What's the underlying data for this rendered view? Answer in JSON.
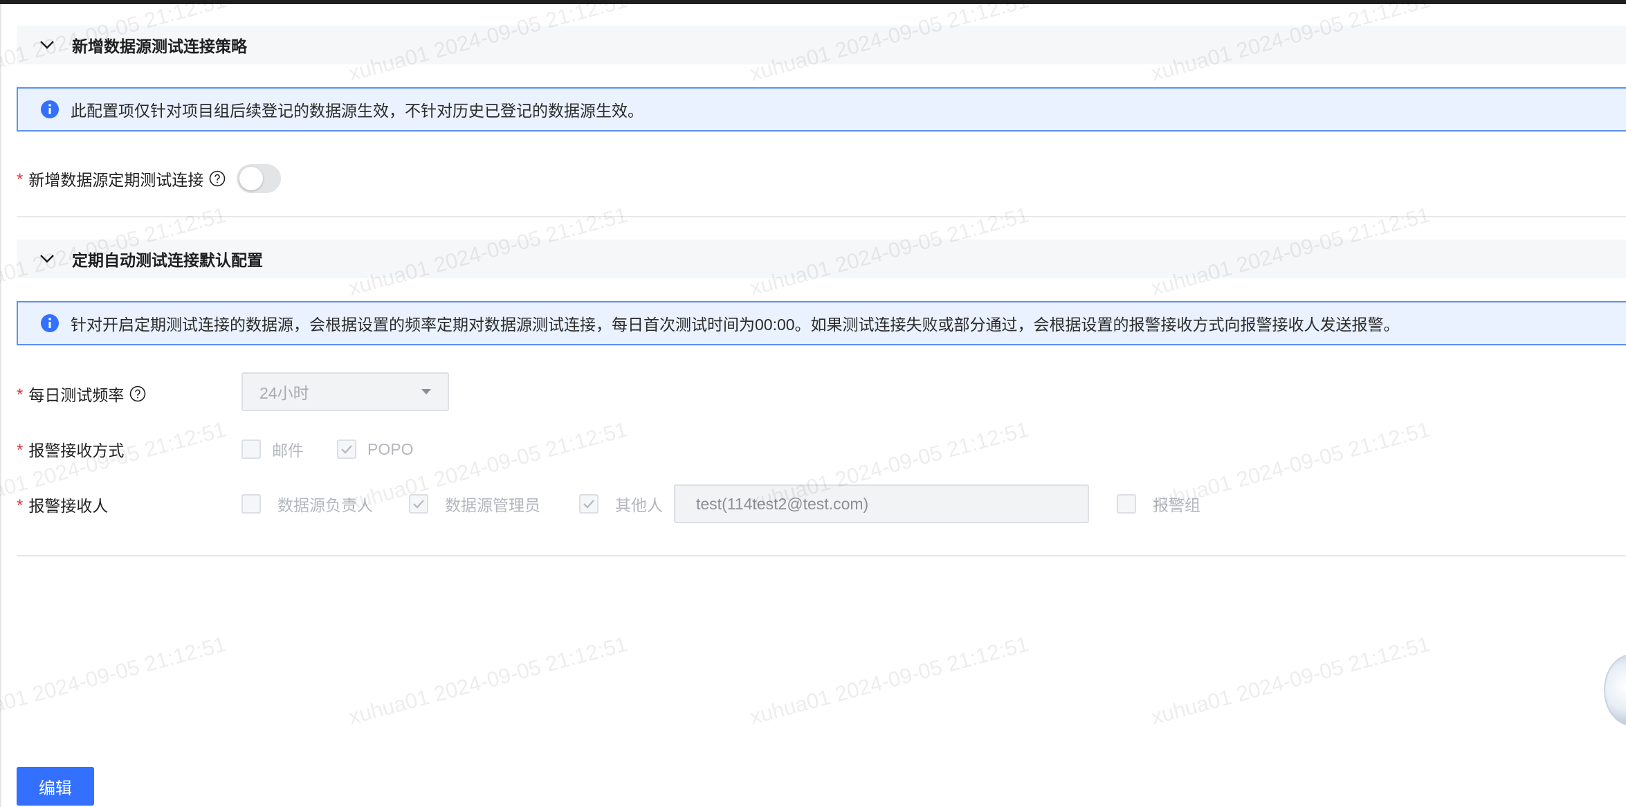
{
  "sections": {
    "new_datasource": {
      "title": "新增数据源测试连接策略",
      "info": "此配置项仅针对项目组后续登记的数据源生效，不针对历史已登记的数据源生效。",
      "toggle_label": "新增数据源定期测试连接",
      "toggle_on": false
    },
    "auto_test": {
      "title": "定期自动测试连接默认配置",
      "info": "针对开启定期测试连接的数据源，会根据设置的频率定期对数据源测试连接，每日首次测试时间为00:00。如果测试连接失败或部分通过，会根据设置的报警接收方式向报警接收人发送报警。",
      "frequency_label": "每日测试频率",
      "frequency_value": "24小时",
      "alert_method_label": "报警接收方式",
      "alert_methods": [
        {
          "label": "邮件",
          "checked": false
        },
        {
          "label": "POPO",
          "checked": true
        }
      ],
      "recipients_label": "报警接收人",
      "recipients": [
        {
          "label": "数据源负责人",
          "checked": false
        },
        {
          "label": "数据源管理员",
          "checked": true
        },
        {
          "label": "其他人",
          "checked": true
        }
      ],
      "other_recipient_value": "test(114test2@test.com)",
      "alert_group": {
        "label": "报警组",
        "checked": false
      }
    }
  },
  "required_mark": "*",
  "edit_button_label": "编辑",
  "watermark_text": "xuhua01 2024-09-05 21:12:51",
  "colors": {
    "primary": "#3370ff",
    "info_border": "#5b8ff9",
    "info_bg": "#eaf2ff",
    "required": "#e0393e"
  }
}
